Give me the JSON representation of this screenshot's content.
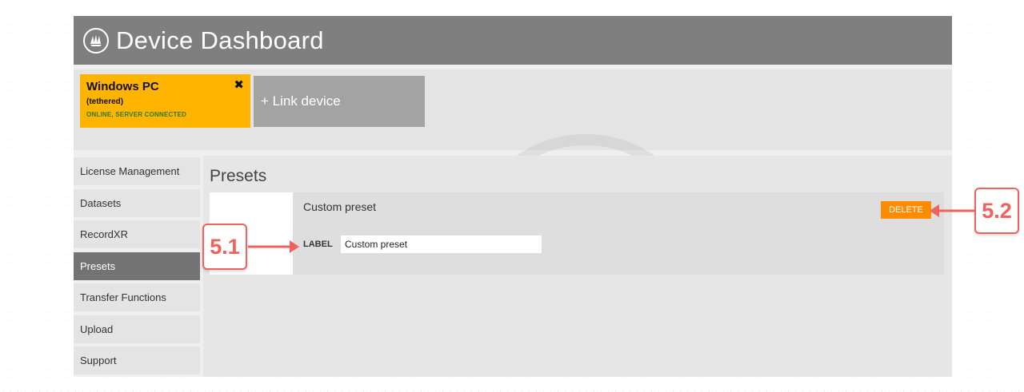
{
  "header": {
    "title": "Device Dashboard",
    "logo_icon": "sailboat-logo-icon"
  },
  "devices": {
    "active": {
      "name": "Windows PC",
      "mode": "(tethered)",
      "status": "ONLINE, SERVER CONNECTED",
      "close_symbol": "✖"
    },
    "link_label": "+ Link device"
  },
  "sidebar": {
    "items": [
      {
        "label": "License Management"
      },
      {
        "label": "Datasets"
      },
      {
        "label": "RecordXR"
      },
      {
        "label": "Presets",
        "active": true
      },
      {
        "label": "Transfer Functions"
      },
      {
        "label": "Upload"
      },
      {
        "label": "Support"
      }
    ]
  },
  "presets": {
    "title": "Presets",
    "item": {
      "name": "Custom preset",
      "label_caption": "LABEL",
      "label_value": "Custom preset",
      "delete_label": "DELETE"
    }
  },
  "annotations": {
    "label_callout": "5.1",
    "delete_callout": "5.2"
  },
  "colors": {
    "header_bg": "#7f7f7f",
    "device_card": "#ffb400",
    "status_green": "#2f7a1f",
    "active_sidebar": "#737373",
    "delete_button": "#ff8c00",
    "callout": "#f0625e"
  }
}
